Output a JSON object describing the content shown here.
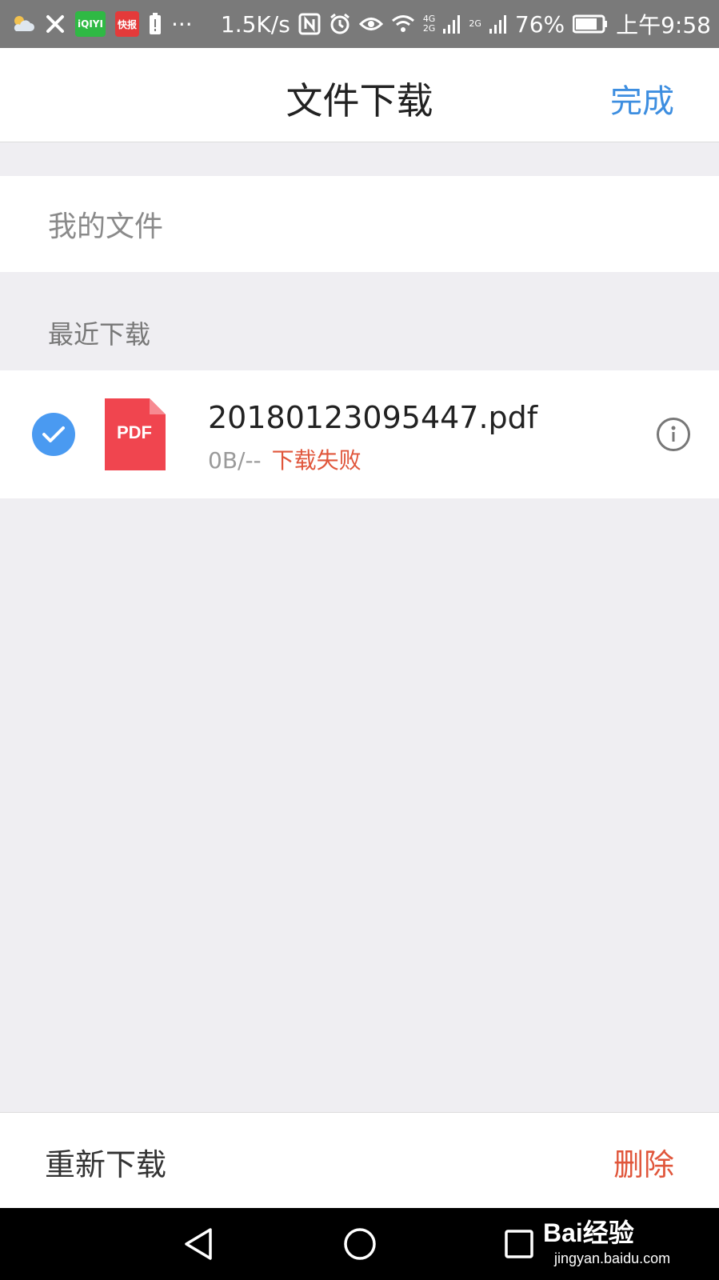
{
  "status_bar": {
    "iqiyi_badge": "iQIYI",
    "kuai_badge": "快报",
    "more": "···",
    "net_speed": "1.5K/s",
    "network_top": "4G",
    "network_bottom": "2G",
    "network2": "2G",
    "battery": "76%",
    "time": "上午9:58"
  },
  "header": {
    "title": "文件下载",
    "done_label": "完成"
  },
  "my_files": {
    "label": "我的文件"
  },
  "recent": {
    "section_label": "最近下载",
    "files": [
      {
        "name": "20180123095447.pdf",
        "size": "0B/--",
        "status": "下载失败",
        "icon_label": "PDF",
        "selected": true
      }
    ]
  },
  "actions": {
    "redownload_label": "重新下载",
    "delete_label": "删除"
  },
  "watermark": {
    "main": "Bai经验",
    "sub": "jingyan.baidu.com"
  },
  "colors": {
    "accent_blue": "#3d8ee0",
    "check_blue": "#4a9af1",
    "error_red": "#e0563b",
    "pdf_red": "#f0454f",
    "background": "#efeef2"
  }
}
